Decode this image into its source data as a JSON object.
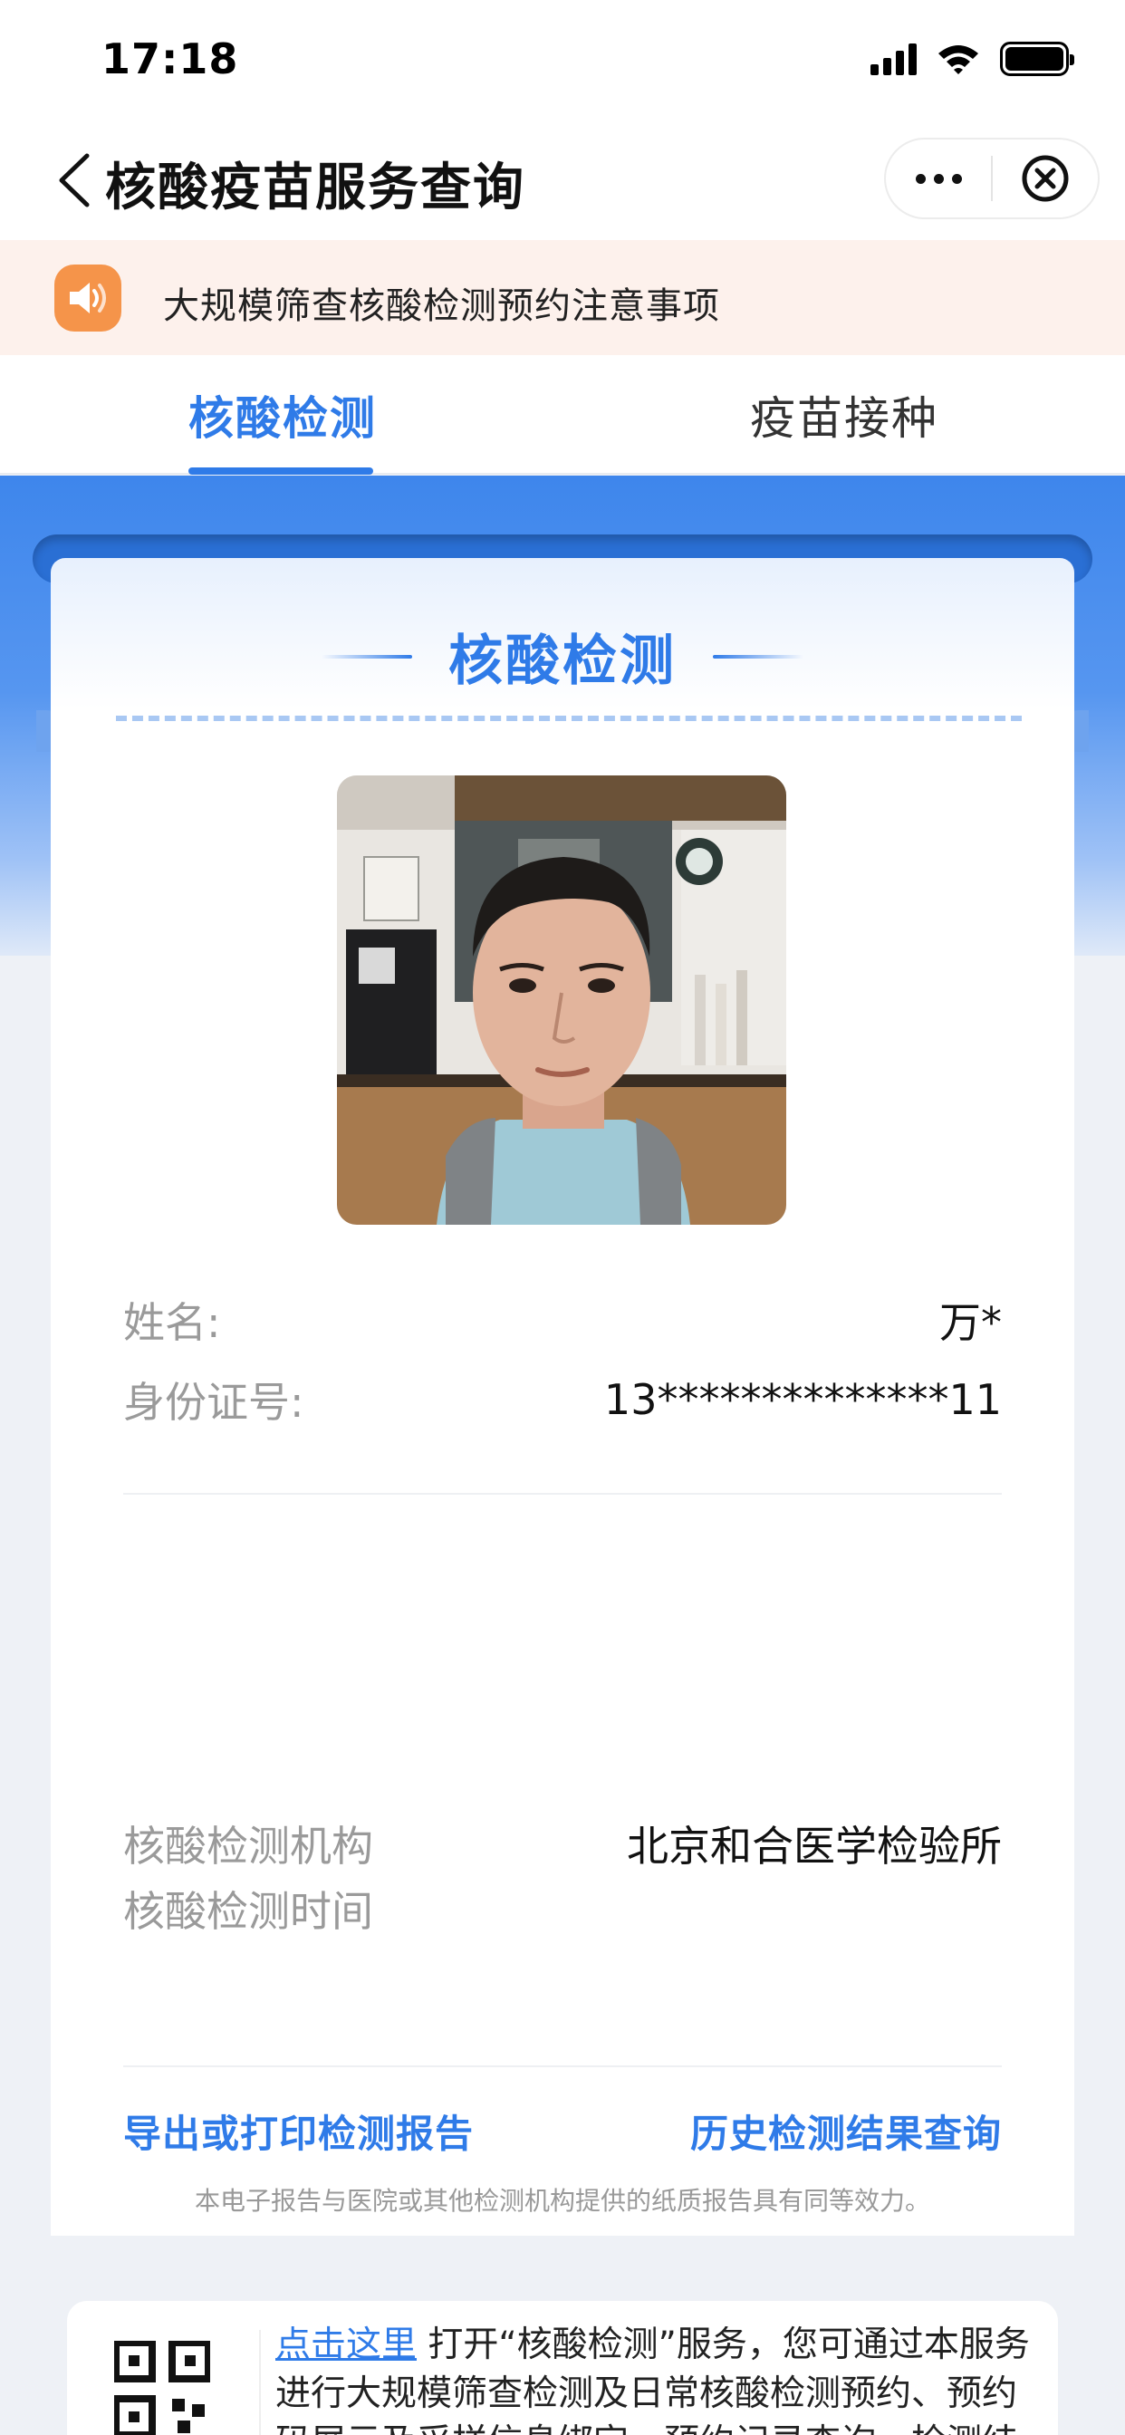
{
  "status_bar": {
    "time": "17:18"
  },
  "nav": {
    "title": "核酸疫苗服务查询"
  },
  "notice": {
    "text": "大规模筛查核酸检测预约注意事项"
  },
  "tabs": [
    {
      "label": "核酸检测",
      "active": true
    },
    {
      "label": "疫苗接种",
      "active": false
    }
  ],
  "card": {
    "title": "核酸检测",
    "name_label": "姓名:",
    "name_value": "万*",
    "id_label": "身份证号:",
    "id_value": "13**************11",
    "org_label": "核酸检测机构",
    "org_value": "北京和合医学检验所",
    "time_label": "核酸检测时间",
    "time_value": "",
    "export_link": "导出或打印检测报告",
    "history_link": "历史检测结果查询",
    "disclaimer": "本电子报告与医院或其他检测机构提供的纸质报告具有同等效力。"
  },
  "bottom": {
    "link": "点击这里",
    "text": " 打开“核酸检测”服务，您可通过本服务进行大规模筛查检测及日常核酸检测预约、预约码展示及采样信息绑定、预约记录查询、检测结"
  },
  "colors": {
    "accent": "#2f7be8",
    "notice_bg": "#fdf1ec",
    "notice_icon": "#f5944a"
  },
  "icons": [
    "back-chevron-icon",
    "more-dots-icon",
    "close-circle-icon",
    "speaker-icon",
    "qr-code-icon",
    "signal-icon",
    "wifi-icon",
    "battery-icon"
  ]
}
